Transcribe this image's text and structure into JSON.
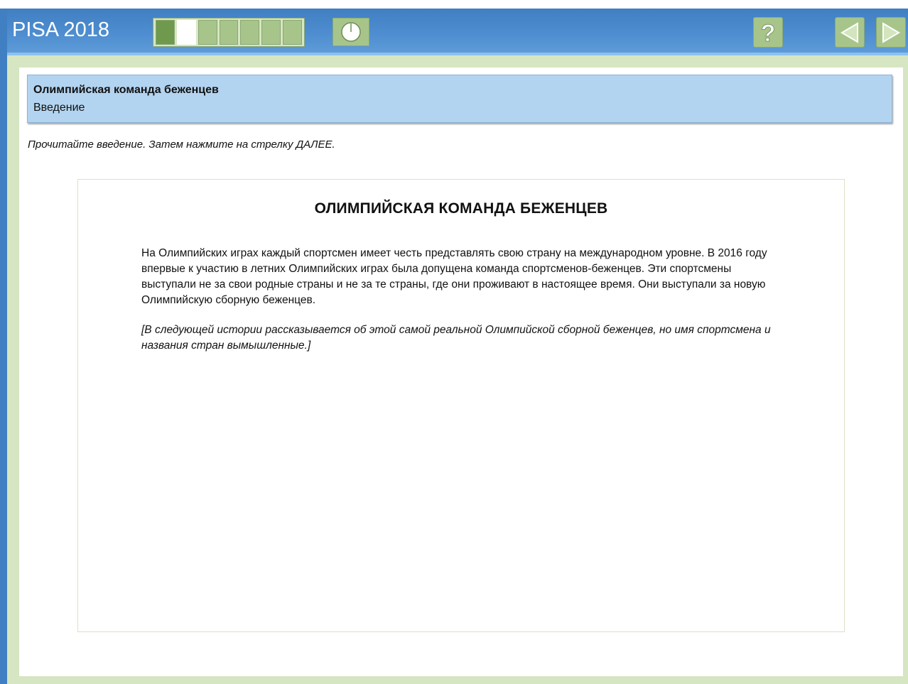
{
  "header": {
    "app_title": "PISA 2018",
    "progress": {
      "total": 7,
      "completed": 1,
      "current": 2
    }
  },
  "unit": {
    "title": "Олимпийская команда беженцев",
    "subtitle": "Введение"
  },
  "instruction": "Прочитайте введение. Затем нажмите на стрелку ДАЛЕЕ.",
  "document": {
    "heading": "ОЛИМПИЙСКАЯ КОМАНДА БЕЖЕНЦЕВ",
    "body": "На Олимпийских играх каждый спортсмен имеет честь представлять свою страну на международном уровне. В 2016 году впервые к участию в летних Олимпийских играх была допущена команда спортсменов-беженцев. Эти спортсмены выступали не за свои родные страны и не за те страны, где они проживают в настоящее время. Они выступали за новую Олимпийскую сборную беженцев.",
    "note": "[В следующей истории рассказывается об этой самой реальной Олимпийской сборной беженцев, но имя спортсмена и названия стран вымышленные.]"
  },
  "icons": {
    "timer": "clock-icon",
    "help": "question-mark-icon",
    "back": "back-arrow-icon",
    "next": "next-arrow-icon"
  },
  "colors": {
    "header_blue": "#4f8ed0",
    "button_green": "#a7c58a",
    "banner_blue": "#b3d4f0",
    "content_bg": "#d6e5c2"
  }
}
